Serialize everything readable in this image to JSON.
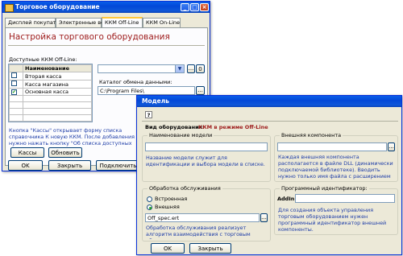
{
  "main_window": {
    "title": "Торговое оборудование",
    "tabs": [
      "Дисплей покупателя",
      "Электронные весы",
      "ККМ Off-Line",
      "ККМ On-Line"
    ],
    "heading": "Настройка торгового оборудования",
    "list_label": "Доступные ККМ Off-Line:",
    "table_header": "Наименование",
    "rows": [
      {
        "name": "Вторая касса",
        "checked": false
      },
      {
        "name": "Касса магазина",
        "checked": false
      },
      {
        "name": "Основная касса",
        "checked": true
      }
    ],
    "model_select": "",
    "catalog_label": "Каталог обмена данными:",
    "catalog_value": "C:\\Program Files\\",
    "hint": "Кнопка \"Кассы\" открывает форму списка справочника К новую ККМ. После добавления нужно нажать кнопку \"Об списка доступных ККМ.",
    "btn_kassy": "Кассы",
    "btn_update": "Обновить",
    "btn_ok": "OK",
    "btn_close": "Закрыть",
    "btn_connect": "Подключить",
    "btn_dots": "...",
    "btn_zero": "0"
  },
  "model_window": {
    "title": "Модель",
    "help": "?",
    "equipment_label": "Вид оборудования:",
    "equipment_value": "ККМ в режиме Off-Line",
    "name_group": "Наименование модели",
    "name_value": "",
    "name_hint": "Название модели служит для идентификации и выбора модели в списке.",
    "ext_group": "Внешняя компонента",
    "ext_value": "",
    "ext_hint": "Каждая внешняя компонента располагается в файле DLL (динамически подключаемой библиотеке). Вводить нужно только имя файла с расширением без полного пути.",
    "processing_group": "Обработка обслуживания",
    "radio_builtin": "Встроенная",
    "radio_external": "Внешняя",
    "processing_file": "Off_spec.ert",
    "processing_hint": "Обработка обслуживания реализует алгоритм взаимодействия с торговым оборудованием.",
    "progid_group": "Программный идентификатор:",
    "progid_prefix": "AddIn.",
    "progid_value": "",
    "progid_hint": "Для создания объекта управления торговым оборудованием нужен программный идентификатор внешней компоненты.",
    "btn_ok": "OK",
    "btn_close": "Закрыть",
    "btn_dots": "..."
  },
  "colors": {
    "heading": "#9d1a1a",
    "hint": "#1f3ea8",
    "titlebar": "#0348d8"
  }
}
